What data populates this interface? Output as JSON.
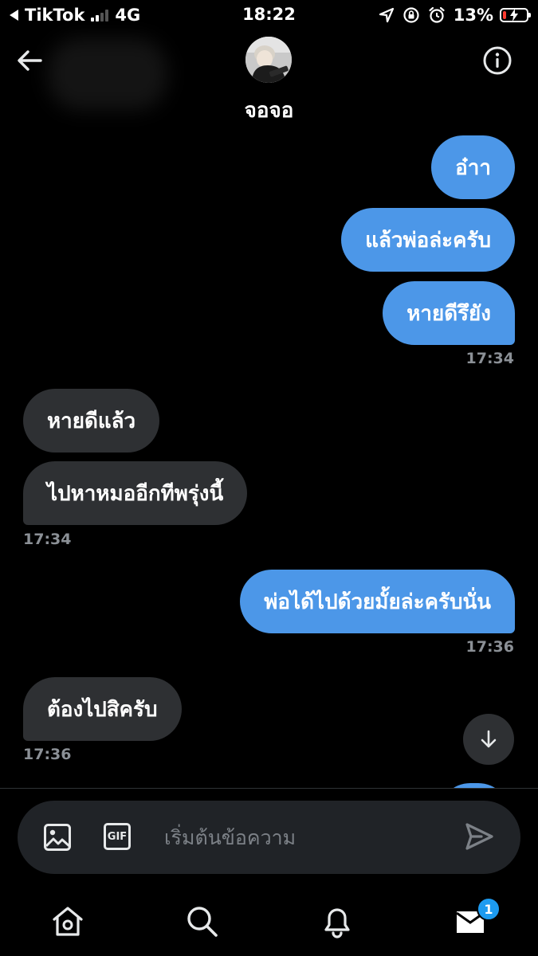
{
  "status_bar": {
    "back_app": "TikTok",
    "network": "4G",
    "time": "18:22",
    "battery_percent": "13%",
    "battery_level": 0.13,
    "signal_bars_active": 2,
    "icons": [
      "location-icon",
      "rotation-lock-icon",
      "alarm-icon",
      "battery-charging-icon"
    ]
  },
  "header": {
    "contact_name": "จอจอ",
    "back_icon": "back-arrow-icon",
    "info_icon": "info-icon"
  },
  "messages": [
    {
      "direction": "sent",
      "text": "อ๋าา"
    },
    {
      "direction": "sent",
      "text": "แล้วพ่อล่ะครับ"
    },
    {
      "direction": "sent",
      "text": "หายดีรึยัง",
      "time": "17:34"
    },
    {
      "direction": "received",
      "text": "หายดีแล้ว"
    },
    {
      "direction": "received",
      "text": "ไปหาหมออีกทีพรุ่งนี้",
      "time": "17:34"
    },
    {
      "direction": "sent",
      "text": "พ่อได้ไปด้วยมั้ยล่ะครับนั่น",
      "time": "17:36"
    },
    {
      "direction": "received",
      "text": "ต้องไปสิครับ",
      "time": "17:36"
    }
  ],
  "composer": {
    "placeholder": "เริ่มต้นข้อความ",
    "gif_label": "GIF",
    "icons": [
      "image-icon",
      "gif-icon",
      "send-icon"
    ]
  },
  "bottom_nav": {
    "items": [
      "home-icon",
      "search-icon",
      "notifications-icon",
      "messages-icon"
    ],
    "messages_badge": "1"
  },
  "colors": {
    "background": "#000000",
    "sent_bubble": "#4c97e8",
    "received_bubble": "#2e3033",
    "timestamp": "#8b9096",
    "badge": "#1d9bf0"
  }
}
